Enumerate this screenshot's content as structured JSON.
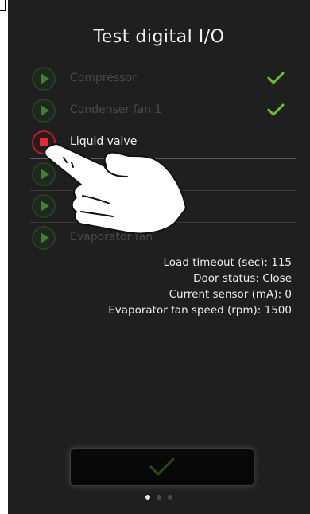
{
  "screen": {
    "title": "Test digital I/O"
  },
  "outputs": [
    {
      "label": "Compressor",
      "state": "done",
      "icon": "play-icon",
      "checked": true
    },
    {
      "label": "Condenser fan 1",
      "state": "done",
      "icon": "play-icon",
      "checked": true
    },
    {
      "label": "Liquid valve",
      "state": "running",
      "icon": "stop-icon",
      "checked": false
    },
    {
      "label": "",
      "state": "idle",
      "icon": "play-icon",
      "checked": false
    },
    {
      "label": "",
      "state": "idle",
      "icon": "play-icon",
      "checked": false
    },
    {
      "label": "Evaporator fan",
      "state": "idle",
      "icon": "play-icon",
      "checked": false
    }
  ],
  "info": {
    "load_timeout": "Load timeout (sec): 115",
    "door_status": "Door status: Close",
    "current_sensor": "Current sensor (mA): 0",
    "evaporator_fan_speed": "Evaporator fan speed (rpm): 1500"
  },
  "confirm_button": {
    "icon": "check-icon"
  },
  "pager": {
    "pages": 3,
    "current": 1
  },
  "colors": {
    "background": "#1f1f1f",
    "accent_green": "#6abf3a",
    "dim_green": "#4a7a35",
    "stop_red": "#e0283a"
  }
}
